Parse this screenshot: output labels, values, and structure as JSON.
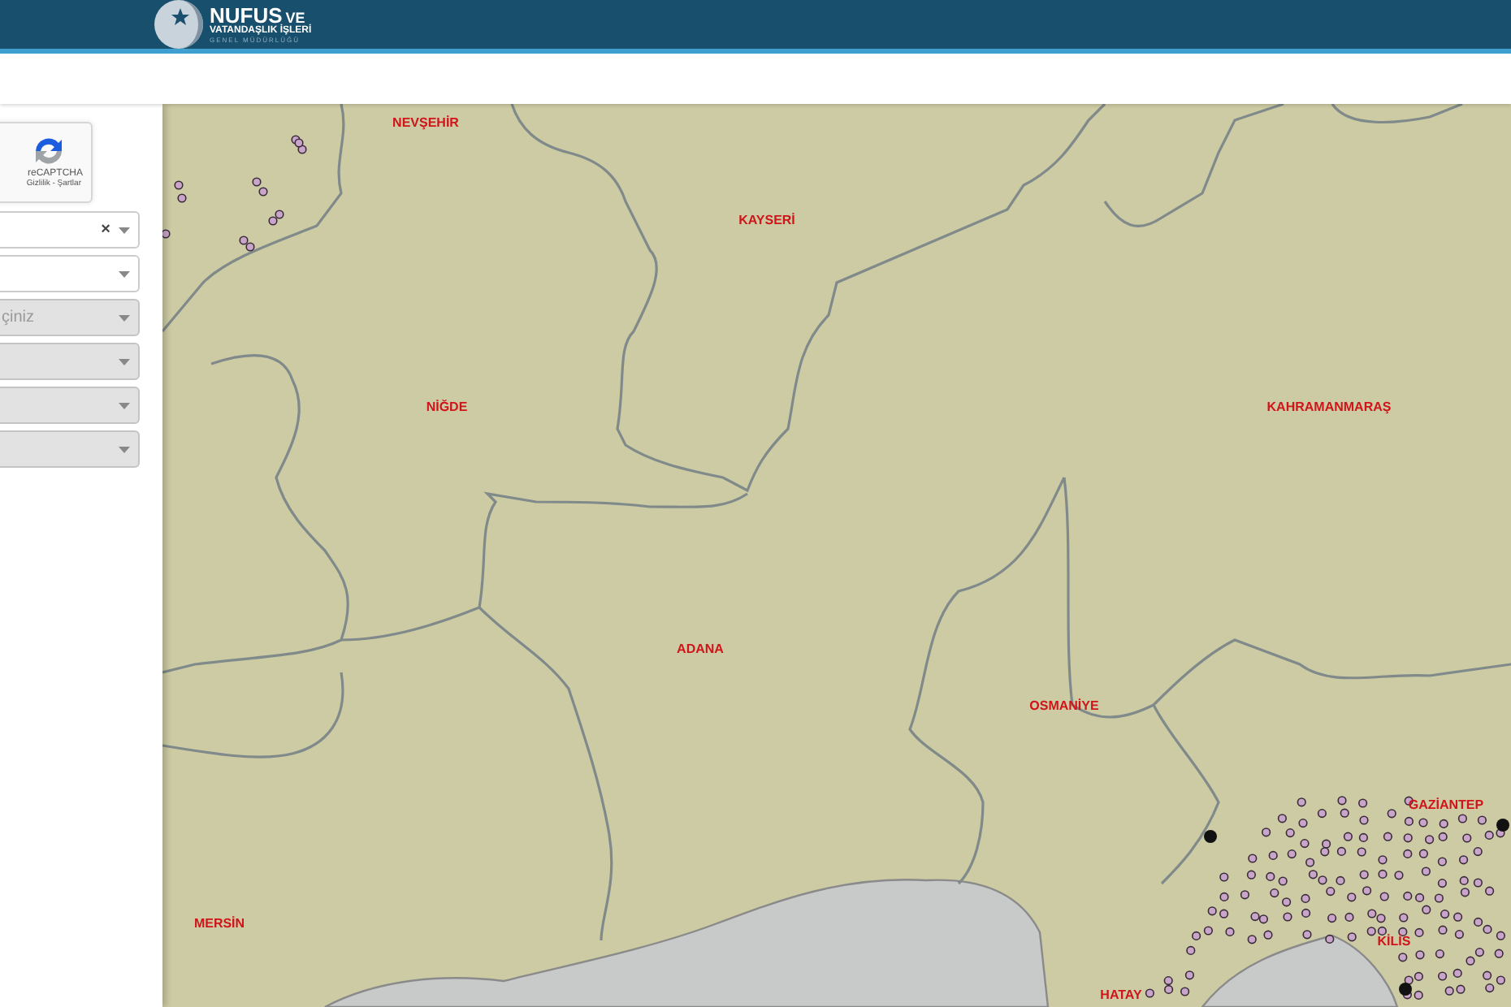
{
  "header": {
    "logo_title": "NUFUS",
    "logo_title_small": "VE",
    "logo_subtitle": "VATANDAŞLIK İŞLERİ",
    "logo_tagline": "GENEL MÜDÜRLÜĞÜ"
  },
  "sidebar": {
    "captcha": {
      "label": "reCAPTCHA",
      "links": "Gizlilik - Şartlar"
    },
    "dropdowns": [
      {
        "disabled": false,
        "clear": "×"
      },
      {
        "disabled": false
      },
      {
        "disabled": true,
        "placeholder": "çiniz"
      },
      {
        "disabled": true
      },
      {
        "disabled": true
      },
      {
        "disabled": true
      }
    ]
  },
  "map": {
    "labels": [
      {
        "text": "NEVŞEHİR"
      },
      {
        "text": "KAYSERİ"
      },
      {
        "text": "NİĞDE"
      },
      {
        "text": "KAHRAMANMARAŞ"
      },
      {
        "text": "ADANA"
      },
      {
        "text": "OSMANİYE"
      },
      {
        "text": "GAZİANTEP"
      },
      {
        "text": "MERSİN"
      },
      {
        "text": "KİLİS"
      },
      {
        "text": "HATAY"
      }
    ]
  }
}
